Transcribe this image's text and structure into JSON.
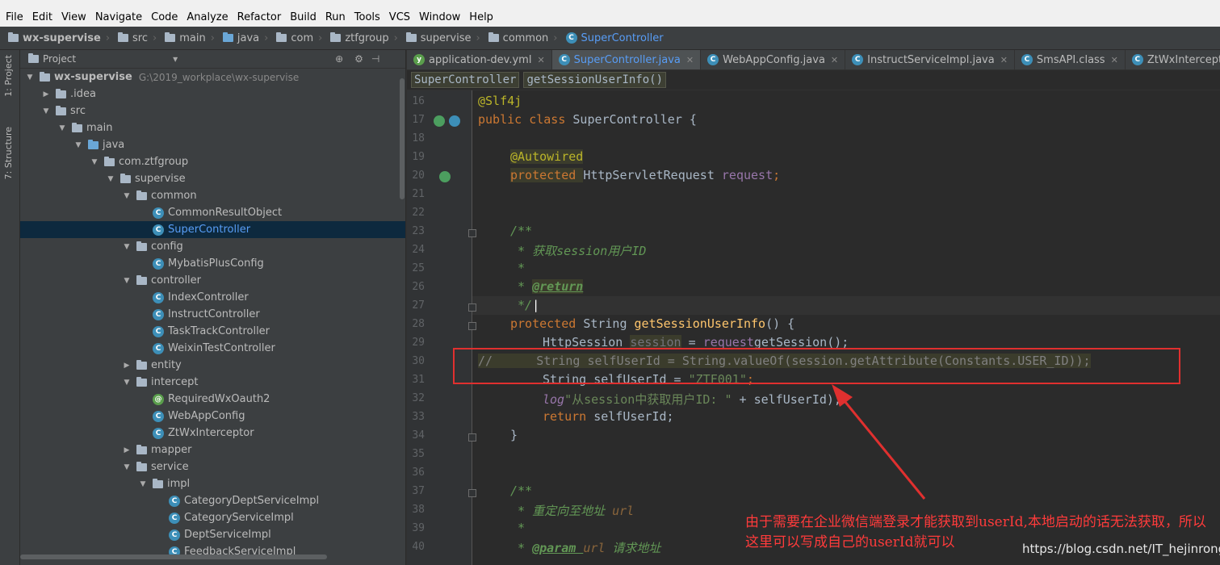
{
  "menu": [
    "File",
    "Edit",
    "View",
    "Navigate",
    "Code",
    "Analyze",
    "Refactor",
    "Build",
    "Run",
    "Tools",
    "VCS",
    "Window",
    "Help"
  ],
  "breadcrumb": [
    "wx-supervise",
    "src",
    "main",
    "java",
    "com",
    "ztfgroup",
    "supervise",
    "common",
    "SuperController"
  ],
  "left_strip": {
    "project": "1: Project",
    "structure": "7: Structure"
  },
  "project_panel": {
    "title": "Project",
    "rows": [
      {
        "label": "wx-supervise",
        "path": "G:\\2019_workplace\\wx-supervise"
      },
      {
        "label": ".idea"
      },
      {
        "label": "src"
      },
      {
        "label": "main"
      },
      {
        "label": "java"
      },
      {
        "label": "com.ztfgroup"
      },
      {
        "label": "supervise"
      },
      {
        "label": "common"
      },
      {
        "label": "CommonResultObject"
      },
      {
        "label": "SuperController"
      },
      {
        "label": "config"
      },
      {
        "label": "MybatisPlusConfig"
      },
      {
        "label": "controller"
      },
      {
        "label": "IndexController"
      },
      {
        "label": "InstructController"
      },
      {
        "label": "TaskTrackController"
      },
      {
        "label": "WeixinTestController"
      },
      {
        "label": "entity"
      },
      {
        "label": "intercept"
      },
      {
        "label": "RequiredWxOauth2"
      },
      {
        "label": "WebAppConfig"
      },
      {
        "label": "ZtWxInterceptor"
      },
      {
        "label": "mapper"
      },
      {
        "label": "service"
      },
      {
        "label": "impl"
      },
      {
        "label": "CategoryDeptServiceImpl"
      },
      {
        "label": "CategoryServiceImpl"
      },
      {
        "label": "DeptServiceImpl"
      },
      {
        "label": "FeedbackServiceImpl"
      }
    ]
  },
  "tabs": [
    "application-dev.yml",
    "SuperController.java",
    "WebAppConfig.java",
    "InstructServiceImpl.java",
    "SmsAPI.class",
    "ZtWxInterceptor.java"
  ],
  "editor_breadcrumb": [
    "SuperController",
    "getSessionUserInfo()"
  ],
  "line_numbers": [
    "16",
    "17",
    "18",
    "19",
    "20",
    "21",
    "22",
    "23",
    "24",
    "25",
    "26",
    "27",
    "28",
    "29",
    "30",
    "31",
    "32",
    "33",
    "34",
    "35",
    "36",
    "37",
    "38",
    "39",
    "40"
  ],
  "code": {
    "l16": "@Slf4j",
    "l17a": "public class ",
    "l17b": "SuperController {",
    "l19": "@Autowired",
    "l20a": "protected ",
    "l20b": "HttpServletRequest ",
    "l20c": "request",
    ";": ";",
    "l23": "/**",
    "l24a": " * 获取",
    "l24b": "session",
    "l24c": "用户",
    "l24d": "ID",
    "l25": " *",
    "l26a": " * ",
    "l26b": "@return",
    "l27": " */",
    "l28a": "protected ",
    "l28b": "String ",
    "l28c": "getSessionUserInfo",
    "l28d": "() {",
    "l29a": "HttpSession ",
    "l29b": "session",
    " l29c": " = ",
    "l29d": "request",
    ".": ".",
    "l29e": "getSession();",
    "l30": "//      String selfUserId = String.valueOf(session.getAttribute(Constants.USER_ID));",
    "l31a": "String selfUserId = ",
    "l31b": "\"ZTF001\"",
    "l31c": ";",
    "l32a": "log",
    ".info": ".info(",
    "l32b": "\"从session中获取用户ID: \"",
    "l32c": " + selfUserId);",
    "l33a": "return ",
    "l33b": "selfUserId;",
    "l34": "}",
    "l37": "/**",
    "l38a": " * 重定向至地址 ",
    "l38b": "url",
    "l39": " *",
    "l40a": " * ",
    "l40b": "@param ",
    "l40c": "url",
    " l40d": " 请求地址"
  },
  "annotation_note": "由于需要在企业微信端登录才能获取到userId,本地启动的话无法获取，所以这里可以写成自己的userId就可以",
  "watermark": "https://blog.csdn.net/IT_hejinrong",
  "colors": {
    "annotation_red": "#e0302f",
    "selection": "#0d293e",
    "keyword": "#cc7832"
  }
}
